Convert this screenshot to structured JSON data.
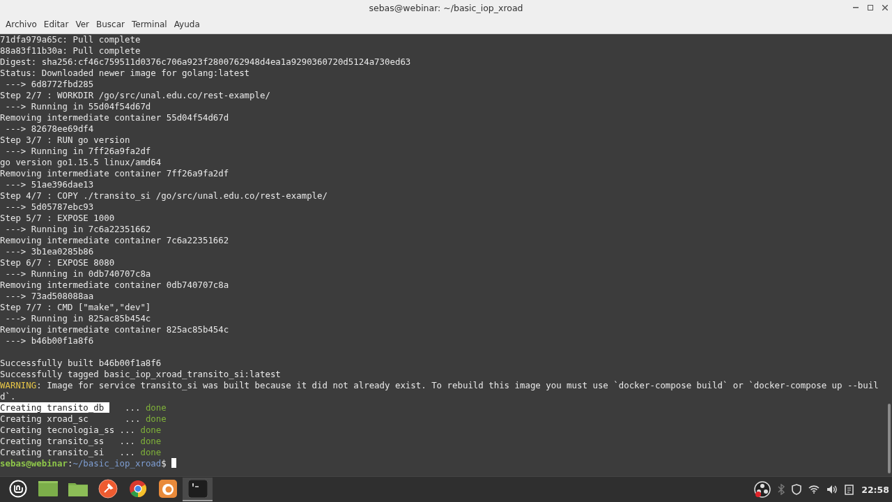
{
  "window": {
    "title": "sebas@webinar: ~/basic_iop_xroad"
  },
  "menu": [
    "Archivo",
    "Editar",
    "Ver",
    "Buscar",
    "Terminal",
    "Ayuda"
  ],
  "terminal": {
    "lines": [
      {
        "kind": "text",
        "segments": [
          {
            "kind": "plain",
            "text": "71dfa979a65c: Pull complete"
          }
        ]
      },
      {
        "kind": "text",
        "segments": [
          {
            "kind": "plain",
            "text": "88a83f11b30a: Pull complete"
          }
        ]
      },
      {
        "kind": "text",
        "segments": [
          {
            "kind": "plain",
            "text": "Digest: sha256:cf46c759511d0376c706a923f2800762948d4ea1a9290360720d5124a730ed63"
          }
        ]
      },
      {
        "kind": "text",
        "segments": [
          {
            "kind": "plain",
            "text": "Status: Downloaded newer image for golang:latest"
          }
        ]
      },
      {
        "kind": "text",
        "segments": [
          {
            "kind": "plain",
            "text": " ---> 6d8772fbd285"
          }
        ]
      },
      {
        "kind": "text",
        "segments": [
          {
            "kind": "plain",
            "text": "Step 2/7 : WORKDIR /go/src/unal.edu.co/rest-example/"
          }
        ]
      },
      {
        "kind": "text",
        "segments": [
          {
            "kind": "plain",
            "text": " ---> Running in 55d04f54d67d"
          }
        ]
      },
      {
        "kind": "text",
        "segments": [
          {
            "kind": "plain",
            "text": "Removing intermediate container 55d04f54d67d"
          }
        ]
      },
      {
        "kind": "text",
        "segments": [
          {
            "kind": "plain",
            "text": " ---> 82678ee69df4"
          }
        ]
      },
      {
        "kind": "text",
        "segments": [
          {
            "kind": "plain",
            "text": "Step 3/7 : RUN go version"
          }
        ]
      },
      {
        "kind": "text",
        "segments": [
          {
            "kind": "plain",
            "text": " ---> Running in 7ff26a9fa2df"
          }
        ]
      },
      {
        "kind": "text",
        "segments": [
          {
            "kind": "plain",
            "text": "go version go1.15.5 linux/amd64"
          }
        ]
      },
      {
        "kind": "text",
        "segments": [
          {
            "kind": "plain",
            "text": "Removing intermediate container 7ff26a9fa2df"
          }
        ]
      },
      {
        "kind": "text",
        "segments": [
          {
            "kind": "plain",
            "text": " ---> 51ae396dae13"
          }
        ]
      },
      {
        "kind": "text",
        "segments": [
          {
            "kind": "plain",
            "text": "Step 4/7 : COPY ./transito_si /go/src/unal.edu.co/rest-example/"
          }
        ]
      },
      {
        "kind": "text",
        "segments": [
          {
            "kind": "plain",
            "text": " ---> 5d05787ebc93"
          }
        ]
      },
      {
        "kind": "text",
        "segments": [
          {
            "kind": "plain",
            "text": "Step 5/7 : EXPOSE 1000"
          }
        ]
      },
      {
        "kind": "text",
        "segments": [
          {
            "kind": "plain",
            "text": " ---> Running in 7c6a22351662"
          }
        ]
      },
      {
        "kind": "text",
        "segments": [
          {
            "kind": "plain",
            "text": "Removing intermediate container 7c6a22351662"
          }
        ]
      },
      {
        "kind": "text",
        "segments": [
          {
            "kind": "plain",
            "text": " ---> 3b1ea0285b86"
          }
        ]
      },
      {
        "kind": "text",
        "segments": [
          {
            "kind": "plain",
            "text": "Step 6/7 : EXPOSE 8080"
          }
        ]
      },
      {
        "kind": "text",
        "segments": [
          {
            "kind": "plain",
            "text": " ---> Running in 0db740707c8a"
          }
        ]
      },
      {
        "kind": "text",
        "segments": [
          {
            "kind": "plain",
            "text": "Removing intermediate container 0db740707c8a"
          }
        ]
      },
      {
        "kind": "text",
        "segments": [
          {
            "kind": "plain",
            "text": " ---> 73ad508088aa"
          }
        ]
      },
      {
        "kind": "text",
        "segments": [
          {
            "kind": "plain",
            "text": "Step 7/7 : CMD [\"make\",\"dev\"]"
          }
        ]
      },
      {
        "kind": "text",
        "segments": [
          {
            "kind": "plain",
            "text": " ---> Running in 825ac85b454c"
          }
        ]
      },
      {
        "kind": "text",
        "segments": [
          {
            "kind": "plain",
            "text": "Removing intermediate container 825ac85b454c"
          }
        ]
      },
      {
        "kind": "text",
        "segments": [
          {
            "kind": "plain",
            "text": " ---> b46b00f1a8f6"
          }
        ]
      },
      {
        "kind": "blank"
      },
      {
        "kind": "text",
        "segments": [
          {
            "kind": "plain",
            "text": "Successfully built b46b00f1a8f6"
          }
        ]
      },
      {
        "kind": "text",
        "segments": [
          {
            "kind": "plain",
            "text": "Successfully tagged basic_iop_xroad_transito_si:latest"
          }
        ]
      },
      {
        "kind": "text",
        "segments": [
          {
            "kind": "warning",
            "text": "WARNING"
          },
          {
            "kind": "plain",
            "text": ": Image for service transito_si was built because it did not already exist. To rebuild this image you must use `docker-compose build` or `docker-compose up --buil"
          }
        ]
      },
      {
        "kind": "text",
        "segments": [
          {
            "kind": "plain",
            "text": "d`."
          }
        ]
      },
      {
        "kind": "text",
        "segments": [
          {
            "kind": "selected",
            "text": "Creating transito_db "
          },
          {
            "kind": "plain",
            "text": "   ... "
          },
          {
            "kind": "done",
            "text": "done"
          }
        ]
      },
      {
        "kind": "text",
        "segments": [
          {
            "kind": "plain",
            "text": "Creating xroad_sc       ... "
          },
          {
            "kind": "done",
            "text": "done"
          }
        ]
      },
      {
        "kind": "text",
        "segments": [
          {
            "kind": "plain",
            "text": "Creating tecnologia_ss ... "
          },
          {
            "kind": "done",
            "text": "done"
          }
        ]
      },
      {
        "kind": "text",
        "segments": [
          {
            "kind": "plain",
            "text": "Creating transito_ss   ... "
          },
          {
            "kind": "done",
            "text": "done"
          }
        ]
      },
      {
        "kind": "text",
        "segments": [
          {
            "kind": "plain",
            "text": "Creating transito_si   ... "
          },
          {
            "kind": "done",
            "text": "done"
          }
        ]
      },
      {
        "kind": "prompt",
        "segments": [
          {
            "kind": "user",
            "text": "sebas@webinar"
          },
          {
            "kind": "plain",
            "text": ":"
          },
          {
            "kind": "path",
            "text": "~/basic_iop_xroad"
          },
          {
            "kind": "plain",
            "text": "$ "
          }
        ]
      }
    ]
  },
  "taskbar": {
    "apps": [
      {
        "kind": "menu",
        "selected": false
      },
      {
        "kind": "desktop",
        "selected": false
      },
      {
        "kind": "folder",
        "selected": false
      },
      {
        "kind": "postman",
        "selected": false
      },
      {
        "kind": "chrome",
        "selected": false
      },
      {
        "kind": "firefox",
        "selected": false
      },
      {
        "kind": "terminal",
        "selected": true
      }
    ],
    "clock": "22:58"
  }
}
